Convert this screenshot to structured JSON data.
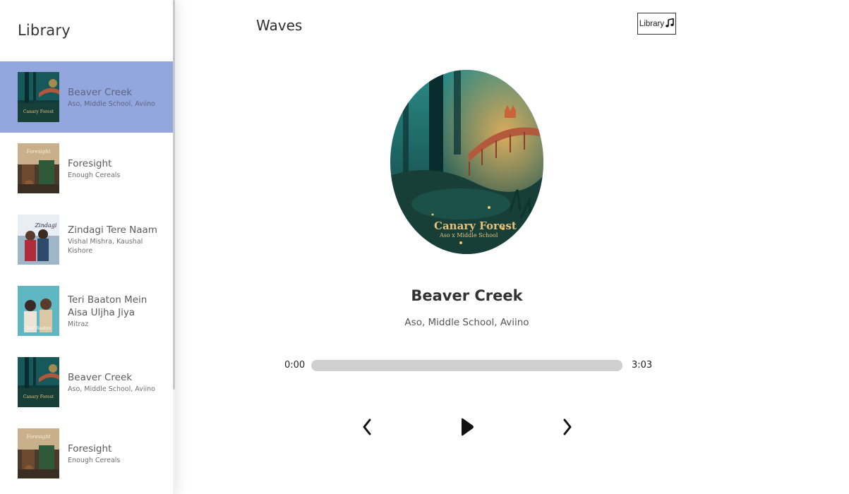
{
  "sidebar": {
    "title": "Library",
    "songs": [
      {
        "name": "Beaver Creek",
        "artist": "Aso, Middle School, Aviino",
        "active": true,
        "cover_text": "Canary Forest"
      },
      {
        "name": "Foresight",
        "artist": "Enough Cereals",
        "active": false,
        "cover_text": "Foresight"
      },
      {
        "name": "Zindagi Tere Naam",
        "artist": "Vishal Mishra, Kaushal Kishore",
        "active": false,
        "cover_text": "Zindagi"
      },
      {
        "name": "Teri Baaton Mein Aisa Uljha Jiya",
        "artist": "Mitraz",
        "active": false,
        "cover_text": "Teri Baaton"
      },
      {
        "name": "Beaver Creek",
        "artist": "Aso, Middle School, Aviino",
        "active": false,
        "cover_text": "Canary Forest"
      },
      {
        "name": "Foresight",
        "artist": "Enough Cereals",
        "active": false,
        "cover_text": "Foresight"
      }
    ]
  },
  "header": {
    "brand": "Waves",
    "library_button_label": "Library",
    "library_button_icon": "music-note-icon"
  },
  "player": {
    "album_art_text": "Canary Forest",
    "album_art_subtext": "Aso x Middle School",
    "track_title": "Beaver Creek",
    "track_artist": "Aso, Middle School, Aviino",
    "current_time": "0:00",
    "duration": "3:03",
    "progress": 0,
    "controls": {
      "previous_icon": "chevron-left-icon",
      "play_icon": "play-icon",
      "next_icon": "chevron-right-icon"
    }
  },
  "colors": {
    "accent": "#93a6de",
    "track_bg": "#cfcfcf",
    "text_dark": "#333333"
  }
}
